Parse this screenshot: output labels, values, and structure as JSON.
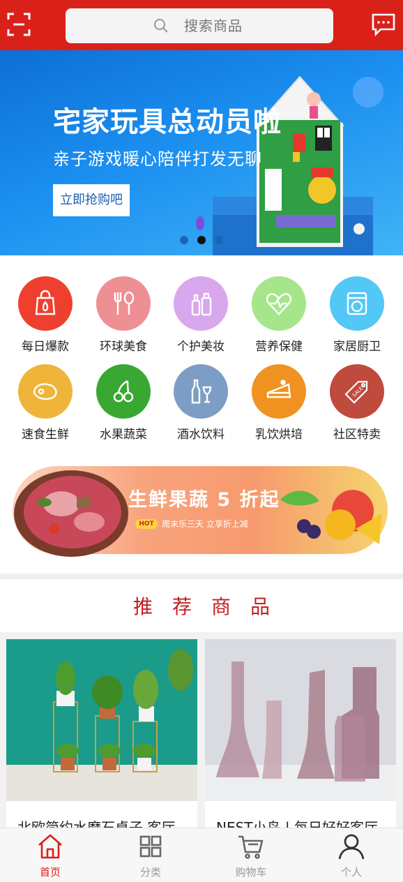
{
  "header": {
    "search_placeholder": "搜索商品",
    "brand_color": "#d9211a"
  },
  "banner": {
    "title": "宅家玩具总动员啦",
    "subtitle": "亲子游戏暖心陪伴打发无聊",
    "button_label": "立即抢购吧",
    "slide_count": 3,
    "active_slide": 2
  },
  "categories": [
    {
      "label": "每日爆款",
      "icon": "hot-bag-icon",
      "color": "#ef3f2f"
    },
    {
      "label": "环球美食",
      "icon": "fork-spoon-icon",
      "color": "#ee8f93"
    },
    {
      "label": "个护美妆",
      "icon": "cosmetics-icon",
      "color": "#d8a7ec"
    },
    {
      "label": "营养保健",
      "icon": "heart-pulse-icon",
      "color": "#a6e68a"
    },
    {
      "label": "家居厨卫",
      "icon": "washing-machine-icon",
      "color": "#53c7f6"
    },
    {
      "label": "速食生鲜",
      "icon": "meat-icon",
      "color": "#efb43a"
    },
    {
      "label": "水果蔬菜",
      "icon": "cherry-icon",
      "color": "#38a833"
    },
    {
      "label": "酒水饮料",
      "icon": "wine-icon",
      "color": "#7d9ec4"
    },
    {
      "label": "乳饮烘培",
      "icon": "cake-icon",
      "color": "#f0921f"
    },
    {
      "label": "社区特卖",
      "icon": "sale-tag-icon",
      "color": "#bf4a3e"
    }
  ],
  "promo": {
    "title": "生鲜果蔬 5 折起",
    "hot_badge": "HOT",
    "subtitle": "周末乐三天 立享折上减"
  },
  "recommend": {
    "title": "推荐商品"
  },
  "products": [
    {
      "name": "北欧简约水磨石桌子 客厅",
      "image": "plant-stands-photo"
    },
    {
      "name": "NEST小鸟 | 每日好好客厅",
      "image": "glass-vases-photo"
    }
  ],
  "tabbar": {
    "items": [
      {
        "label": "首页",
        "icon": "home-icon",
        "active": true
      },
      {
        "label": "分类",
        "icon": "category-grid-icon",
        "active": false
      },
      {
        "label": "购物车",
        "icon": "cart-icon",
        "active": false
      },
      {
        "label": "个人",
        "icon": "user-icon",
        "active": false
      }
    ]
  }
}
